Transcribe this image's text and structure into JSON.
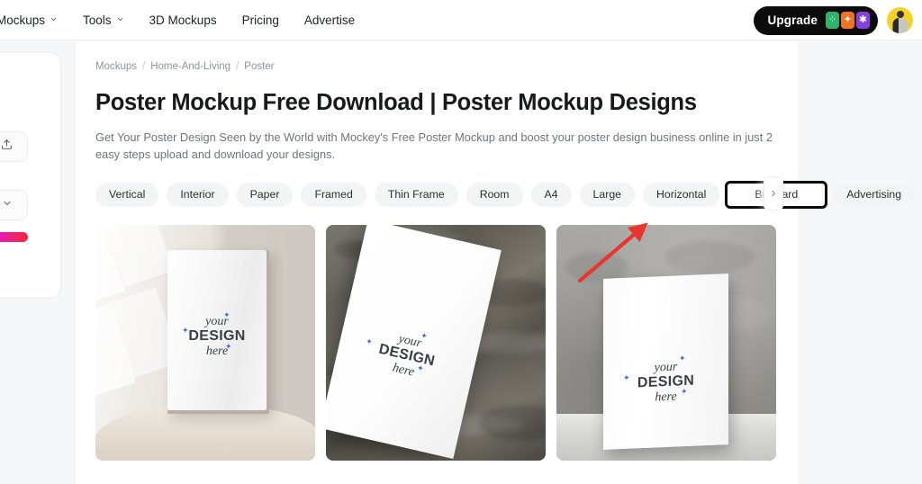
{
  "topnav": {
    "items": [
      {
        "label": "Mockups",
        "icon": "chevron-down-icon",
        "has_caret": true
      },
      {
        "label": "Tools",
        "icon": "chevron-down-icon",
        "has_caret": true
      },
      {
        "label": "3D Mockups",
        "has_caret": false
      },
      {
        "label": "Pricing",
        "has_caret": false
      },
      {
        "label": "Advertise",
        "has_caret": false
      }
    ],
    "upgrade": {
      "label": "Upgrade",
      "icons": [
        {
          "name": "sparkle-green-icon",
          "glyph": "⁘",
          "color": "#2fb36a"
        },
        {
          "name": "star-orange-icon",
          "glyph": "✦",
          "color": "#f07325"
        },
        {
          "name": "asterisk-purple-icon",
          "glyph": "✱",
          "color": "#8b3fe0"
        }
      ]
    },
    "avatar": {
      "name": "user-avatar",
      "background": "#f5d324"
    }
  },
  "sidebar": {
    "upload_button": {
      "icon": "upload-icon"
    },
    "collapse_button": {
      "icon": "chevron-down-icon"
    },
    "gradient_bar": {
      "name": "color-gradient-slider"
    }
  },
  "breadcrumb": {
    "items": [
      "Mockups",
      "Home-And-Living",
      "Poster"
    ],
    "separator": "/"
  },
  "page": {
    "title": "Poster Mockup Free Download | Poster Mockup Designs",
    "description": "Get Your Poster Design Seen by the World with Mockey's Free Poster Mockup and boost your poster design business online in just 2 easy steps upload and download your designs."
  },
  "filters": {
    "chips": [
      {
        "label": "Vertical",
        "highlighted": false
      },
      {
        "label": "Interior",
        "highlighted": false
      },
      {
        "label": "Paper",
        "highlighted": false
      },
      {
        "label": "Framed",
        "highlighted": false
      },
      {
        "label": "Thin Frame",
        "highlighted": false
      },
      {
        "label": "Room",
        "highlighted": false
      },
      {
        "label": "A4",
        "highlighted": false
      },
      {
        "label": "Large",
        "highlighted": false
      },
      {
        "label": "Horizontal",
        "highlighted": false
      },
      {
        "label": "Billboard",
        "highlighted": true
      },
      {
        "label": "Advertising",
        "highlighted": false
      }
    ],
    "scroll_next": {
      "icon": "chevron-right-icon",
      "glyph": "›"
    }
  },
  "artwork": {
    "line1": "your",
    "line2": "DESIGN",
    "line3": "here",
    "sparkle": "✦",
    "sparkle_color": "#3f6fe0"
  },
  "gallery": {
    "cards": [
      {
        "name": "poster-mockup-wall-sunlight",
        "scene": "white poster on beige wall with window sunlight and draped fabric"
      },
      {
        "name": "poster-mockup-stone-flatlay",
        "scene": "tilted white poster on dark textured stone surface"
      },
      {
        "name": "poster-mockup-standing-table",
        "scene": "white poster standing upright on table against grey wall"
      }
    ]
  },
  "annotation": {
    "arrow": {
      "name": "red-pointer-arrow",
      "color": "#e8352e",
      "points_to": "Billboard"
    }
  },
  "colors": {
    "page_bg": "#f6f7f9",
    "panel_bg": "#ffffff",
    "chip_bg": "#f3f4f6",
    "text_primary": "#18191c",
    "text_muted": "#70747d",
    "accent_dark": "#0c0c0d"
  }
}
